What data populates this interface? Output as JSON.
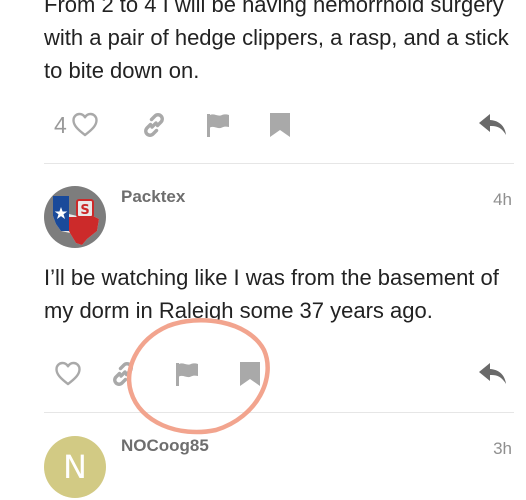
{
  "post1": {
    "text": "From 2 to 4 I will be having hemorrhoid surgery with a pair of hedge clippers, a rasp, and a stick to bite down on.",
    "like_count": "4",
    "actions": [
      "heart-icon",
      "link-icon",
      "flag-icon",
      "bookmark-icon",
      "reply-icon"
    ]
  },
  "post2": {
    "username": "Packtex",
    "timestamp": "4h",
    "text": "I’ll be watching like I was from the basement of my dorm in Raleigh some 37 years ago.",
    "actions": [
      "heart-icon",
      "link-icon",
      "flag-icon",
      "bookmark-icon",
      "reply-icon"
    ]
  },
  "post3": {
    "username": "NOCoog85",
    "timestamp": "3h",
    "avatar_letter": "N",
    "avatar_color": "#d2ca84"
  },
  "colors": {
    "icon": "#a9a9a9",
    "reply_icon": "#6a6a6a",
    "annotation": "#f2a48e"
  }
}
